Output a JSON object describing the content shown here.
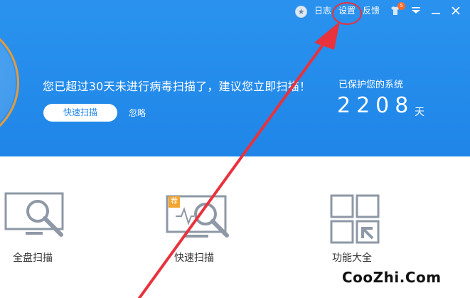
{
  "toolbar": {
    "log_label": "日志",
    "settings_label": "设置",
    "feedback_label": "反馈",
    "badge_count": "5"
  },
  "header": {
    "warning_text": "您已超过30天未进行病毒扫描了，建议您立即扫描！",
    "scan_button_label": "快速扫描",
    "ignore_label": "忽略",
    "protected_label": "已保护您的系统",
    "protected_days": "2208",
    "days_unit": "天"
  },
  "tools": [
    {
      "label": "全盘扫描"
    },
    {
      "label": "快速扫描",
      "recommend_tag": "荐"
    },
    {
      "label": "功能大全"
    }
  ],
  "watermark": "CooZhi.Com",
  "colors": {
    "header_blue": "#1f86e8",
    "ring_orange": "#e39b3c",
    "annotation_red": "#e8323c",
    "icon_gray": "#8e98a6"
  }
}
